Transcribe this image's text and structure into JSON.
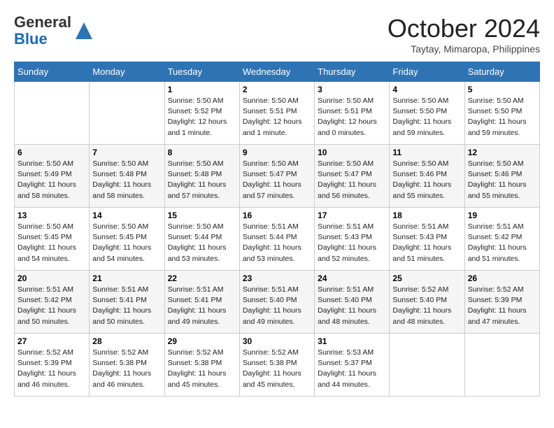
{
  "header": {
    "logo_line1": "General",
    "logo_line2": "Blue",
    "month": "October 2024",
    "location": "Taytay, Mimaropa, Philippines"
  },
  "weekdays": [
    "Sunday",
    "Monday",
    "Tuesday",
    "Wednesday",
    "Thursday",
    "Friday",
    "Saturday"
  ],
  "weeks": [
    [
      {
        "day": "",
        "info": ""
      },
      {
        "day": "",
        "info": ""
      },
      {
        "day": "1",
        "info": "Sunrise: 5:50 AM\nSunset: 5:52 PM\nDaylight: 12 hours\nand 1 minute."
      },
      {
        "day": "2",
        "info": "Sunrise: 5:50 AM\nSunset: 5:51 PM\nDaylight: 12 hours\nand 1 minute."
      },
      {
        "day": "3",
        "info": "Sunrise: 5:50 AM\nSunset: 5:51 PM\nDaylight: 12 hours\nand 0 minutes."
      },
      {
        "day": "4",
        "info": "Sunrise: 5:50 AM\nSunset: 5:50 PM\nDaylight: 11 hours\nand 59 minutes."
      },
      {
        "day": "5",
        "info": "Sunrise: 5:50 AM\nSunset: 5:50 PM\nDaylight: 11 hours\nand 59 minutes."
      }
    ],
    [
      {
        "day": "6",
        "info": "Sunrise: 5:50 AM\nSunset: 5:49 PM\nDaylight: 11 hours\nand 58 minutes."
      },
      {
        "day": "7",
        "info": "Sunrise: 5:50 AM\nSunset: 5:48 PM\nDaylight: 11 hours\nand 58 minutes."
      },
      {
        "day": "8",
        "info": "Sunrise: 5:50 AM\nSunset: 5:48 PM\nDaylight: 11 hours\nand 57 minutes."
      },
      {
        "day": "9",
        "info": "Sunrise: 5:50 AM\nSunset: 5:47 PM\nDaylight: 11 hours\nand 57 minutes."
      },
      {
        "day": "10",
        "info": "Sunrise: 5:50 AM\nSunset: 5:47 PM\nDaylight: 11 hours\nand 56 minutes."
      },
      {
        "day": "11",
        "info": "Sunrise: 5:50 AM\nSunset: 5:46 PM\nDaylight: 11 hours\nand 55 minutes."
      },
      {
        "day": "12",
        "info": "Sunrise: 5:50 AM\nSunset: 5:46 PM\nDaylight: 11 hours\nand 55 minutes."
      }
    ],
    [
      {
        "day": "13",
        "info": "Sunrise: 5:50 AM\nSunset: 5:45 PM\nDaylight: 11 hours\nand 54 minutes."
      },
      {
        "day": "14",
        "info": "Sunrise: 5:50 AM\nSunset: 5:45 PM\nDaylight: 11 hours\nand 54 minutes."
      },
      {
        "day": "15",
        "info": "Sunrise: 5:50 AM\nSunset: 5:44 PM\nDaylight: 11 hours\nand 53 minutes."
      },
      {
        "day": "16",
        "info": "Sunrise: 5:51 AM\nSunset: 5:44 PM\nDaylight: 11 hours\nand 53 minutes."
      },
      {
        "day": "17",
        "info": "Sunrise: 5:51 AM\nSunset: 5:43 PM\nDaylight: 11 hours\nand 52 minutes."
      },
      {
        "day": "18",
        "info": "Sunrise: 5:51 AM\nSunset: 5:43 PM\nDaylight: 11 hours\nand 51 minutes."
      },
      {
        "day": "19",
        "info": "Sunrise: 5:51 AM\nSunset: 5:42 PM\nDaylight: 11 hours\nand 51 minutes."
      }
    ],
    [
      {
        "day": "20",
        "info": "Sunrise: 5:51 AM\nSunset: 5:42 PM\nDaylight: 11 hours\nand 50 minutes."
      },
      {
        "day": "21",
        "info": "Sunrise: 5:51 AM\nSunset: 5:41 PM\nDaylight: 11 hours\nand 50 minutes."
      },
      {
        "day": "22",
        "info": "Sunrise: 5:51 AM\nSunset: 5:41 PM\nDaylight: 11 hours\nand 49 minutes."
      },
      {
        "day": "23",
        "info": "Sunrise: 5:51 AM\nSunset: 5:40 PM\nDaylight: 11 hours\nand 49 minutes."
      },
      {
        "day": "24",
        "info": "Sunrise: 5:51 AM\nSunset: 5:40 PM\nDaylight: 11 hours\nand 48 minutes."
      },
      {
        "day": "25",
        "info": "Sunrise: 5:52 AM\nSunset: 5:40 PM\nDaylight: 11 hours\nand 48 minutes."
      },
      {
        "day": "26",
        "info": "Sunrise: 5:52 AM\nSunset: 5:39 PM\nDaylight: 11 hours\nand 47 minutes."
      }
    ],
    [
      {
        "day": "27",
        "info": "Sunrise: 5:52 AM\nSunset: 5:39 PM\nDaylight: 11 hours\nand 46 minutes."
      },
      {
        "day": "28",
        "info": "Sunrise: 5:52 AM\nSunset: 5:38 PM\nDaylight: 11 hours\nand 46 minutes."
      },
      {
        "day": "29",
        "info": "Sunrise: 5:52 AM\nSunset: 5:38 PM\nDaylight: 11 hours\nand 45 minutes."
      },
      {
        "day": "30",
        "info": "Sunrise: 5:52 AM\nSunset: 5:38 PM\nDaylight: 11 hours\nand 45 minutes."
      },
      {
        "day": "31",
        "info": "Sunrise: 5:53 AM\nSunset: 5:37 PM\nDaylight: 11 hours\nand 44 minutes."
      },
      {
        "day": "",
        "info": ""
      },
      {
        "day": "",
        "info": ""
      }
    ]
  ]
}
